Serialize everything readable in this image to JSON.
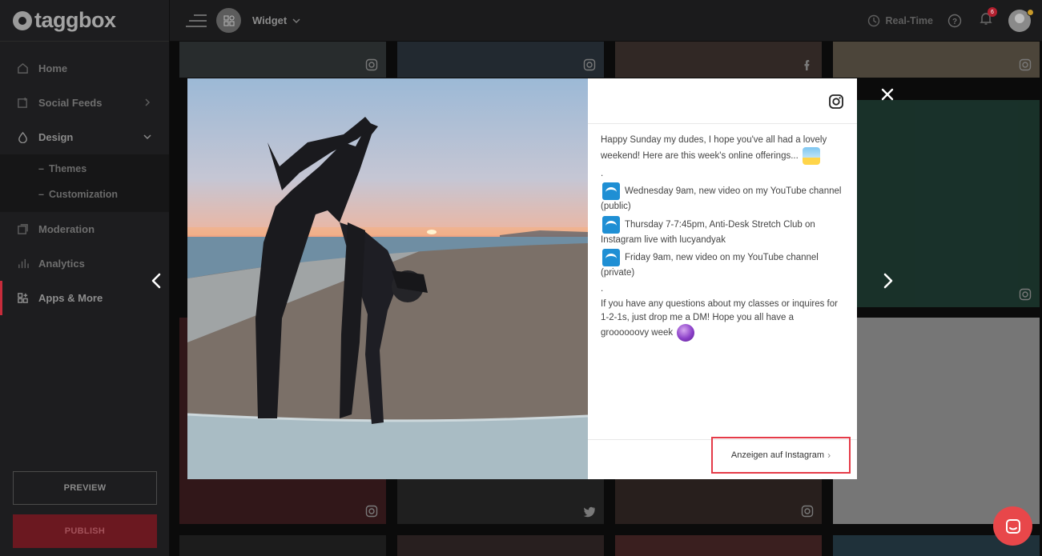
{
  "brand": {
    "name": "taggbox"
  },
  "sidebar": {
    "items": [
      {
        "label": "Home",
        "icon": "home-icon"
      },
      {
        "label": "Social Feeds",
        "icon": "social-feeds-icon"
      },
      {
        "label": "Design",
        "icon": "design-drop-icon"
      },
      {
        "label": "Moderation",
        "icon": "moderation-icon"
      },
      {
        "label": "Analytics",
        "icon": "analytics-icon"
      },
      {
        "label": "Apps & More",
        "icon": "apps-icon"
      }
    ],
    "design_sub": [
      "Themes",
      "Customization"
    ],
    "preview_label": "PREVIEW",
    "publish_label": "PUBLISH"
  },
  "topbar": {
    "widget_label": "Widget",
    "realtime_label": "Real-Time",
    "notification_count": "6"
  },
  "post": {
    "network": "Instagram",
    "caption": [
      "Happy Sunday my dudes, I hope you've all had a lovely weekend! Here are this week's online offerings...",
      ".",
      "Wednesday 9am, new video on my YouTube channel (public)",
      "Thursday 7-7:45pm, Anti-Desk Stretch Club on Instagram live with lucyandyak",
      "Friday 9am, new video on my YouTube channel (private)",
      ".",
      "If you have any questions about my classes or inquires for 1-2-1s, just drop me a DM! Hope you all have a groooooovy week"
    ],
    "view_link": "Anzeigen auf Instagram"
  },
  "colors": {
    "accent_red": "#c72c3b",
    "highlight_border": "#e53b48",
    "chat_bubble": "#e8474a"
  }
}
